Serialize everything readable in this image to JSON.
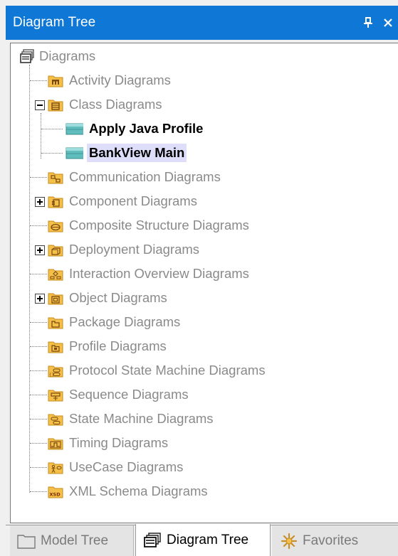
{
  "window": {
    "title": "Diagram Tree"
  },
  "tree": {
    "root": {
      "label": "Diagrams",
      "icon": "diagrams-stack-icon"
    },
    "items": [
      {
        "label": "Activity Diagrams",
        "icon": "activity-diagram-folder-icon",
        "expander": "none"
      },
      {
        "label": "Class Diagrams",
        "icon": "class-diagram-folder-icon",
        "expander": "expanded"
      },
      {
        "label": "Apply Java Profile",
        "icon": "class-diagram-icon",
        "child": true
      },
      {
        "label": "BankView Main",
        "icon": "class-diagram-icon",
        "child": true,
        "selected": true
      },
      {
        "label": "Communication Diagrams",
        "icon": "communication-diagram-folder-icon",
        "expander": "none"
      },
      {
        "label": "Component Diagrams",
        "icon": "component-diagram-folder-icon",
        "expander": "collapsed"
      },
      {
        "label": "Composite Structure Diagrams",
        "icon": "composite-structure-diagram-folder-icon",
        "expander": "none"
      },
      {
        "label": "Deployment Diagrams",
        "icon": "deployment-diagram-folder-icon",
        "expander": "collapsed"
      },
      {
        "label": "Interaction Overview Diagrams",
        "icon": "interaction-overview-diagram-folder-icon",
        "expander": "none"
      },
      {
        "label": "Object Diagrams",
        "icon": "object-diagram-folder-icon",
        "expander": "collapsed"
      },
      {
        "label": "Package Diagrams",
        "icon": "package-diagram-folder-icon",
        "expander": "none"
      },
      {
        "label": "Profile Diagrams",
        "icon": "profile-diagram-folder-icon",
        "expander": "none"
      },
      {
        "label": "Protocol State Machine Diagrams",
        "icon": "protocol-state-machine-diagram-folder-icon",
        "expander": "none"
      },
      {
        "label": "Sequence Diagrams",
        "icon": "sequence-diagram-folder-icon",
        "expander": "none"
      },
      {
        "label": "State Machine Diagrams",
        "icon": "state-machine-diagram-folder-icon",
        "expander": "none"
      },
      {
        "label": "Timing Diagrams",
        "icon": "timing-diagram-folder-icon",
        "expander": "none"
      },
      {
        "label": "UseCase Diagrams",
        "icon": "usecase-diagram-folder-icon",
        "expander": "none"
      },
      {
        "label": "XML Schema Diagrams",
        "icon": "xml-schema-diagram-folder-icon",
        "expander": "none"
      }
    ],
    "xsd_badge": "XSD"
  },
  "tabs": [
    {
      "label": "Model Tree",
      "icon": "model-tree-icon",
      "active": false
    },
    {
      "label": "Diagram Tree",
      "icon": "diagram-tree-icon",
      "active": true
    },
    {
      "label": "Favorites",
      "icon": "favorites-icon",
      "active": false
    }
  ],
  "colors": {
    "titlebar": "#0f78d7",
    "folder": "#f5c04a",
    "folder_border": "#c58a1a",
    "selection": "#dedefb",
    "diagram_icon": "#5fbdbd"
  }
}
